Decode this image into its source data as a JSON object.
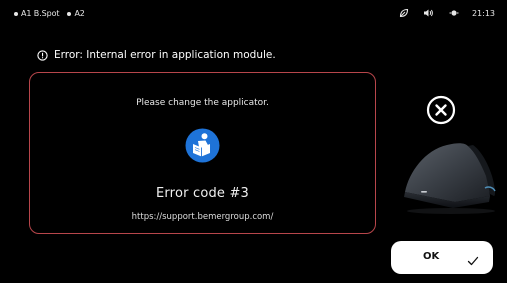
{
  "status_bar": {
    "items": [
      "A1 B.Spot",
      "A2"
    ],
    "time": "21:13",
    "icons": [
      "leaf-icon",
      "speaker-icon",
      "sun-icon"
    ]
  },
  "error_header": {
    "text": "Error: Internal error in application module.",
    "icon": "info-icon"
  },
  "dialog": {
    "message": "Please change the applicator.",
    "icon": "manual-reading-icon",
    "error_code": "Error code #3",
    "url": "https://support.bemergroup.com/",
    "border_color": "#b8464b",
    "icon_color": "#1e73d8"
  },
  "close_button": {
    "icon": "close-icon"
  },
  "ok_button": {
    "label": "OK",
    "icon": "check-icon"
  }
}
